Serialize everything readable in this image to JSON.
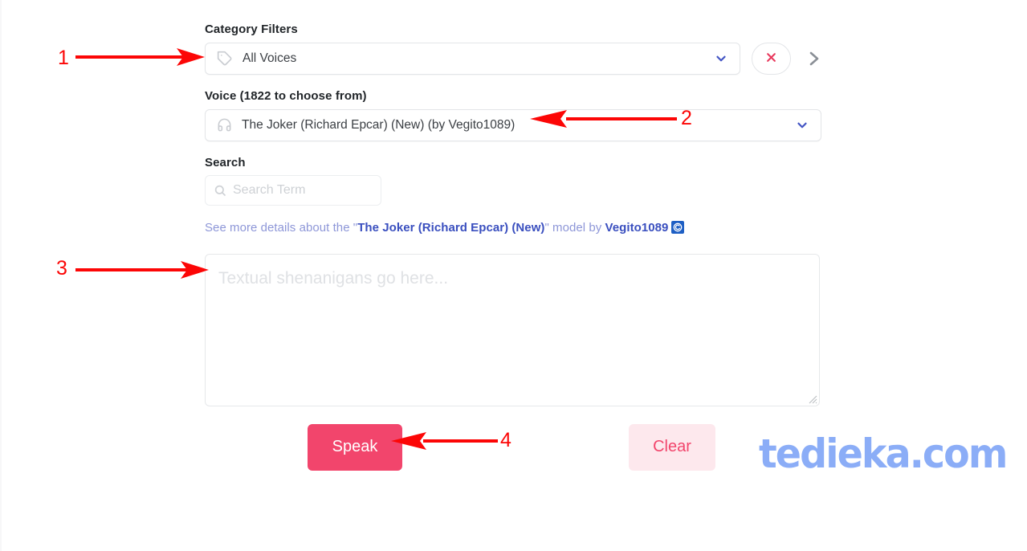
{
  "page": {
    "background": "#ffffff"
  },
  "category_filter": {
    "label": "Category Filters",
    "icon": "tag-icon",
    "value": "All Voices",
    "chevron_icon": "chevron-down-icon",
    "clear_button_icon": "close-x-icon",
    "next_button_icon": "chevron-right-icon",
    "accent": "#4355c4",
    "clear_color": "#e8385c"
  },
  "voice": {
    "label": "Voice (1822 to choose from)",
    "icon": "headphones-icon",
    "value": "The Joker (Richard Epcar) (New) (by Vegito1089)",
    "chevron_icon": "chevron-down-icon"
  },
  "search": {
    "label": "Search",
    "icon": "search-icon",
    "value": "",
    "placeholder": "Search Term"
  },
  "details": {
    "prefix": "See more details about the \"",
    "model_name": "The Joker (Richard Epcar) (New)",
    "middle": "\" model by ",
    "author": "Vegito1089",
    "badge_icon": "spiral-badge-icon",
    "link_color": "#3a4fbf"
  },
  "text_input": {
    "value": "",
    "placeholder": "Textual shenanigans go here..."
  },
  "actions": {
    "speak_label": "Speak",
    "speak_color": "#f2456c",
    "clear_label": "Clear",
    "clear_bg": "#fde8ed",
    "clear_color": "#f2456c"
  },
  "watermark": {
    "text": "tedieka.com",
    "color": "#8badf7"
  },
  "annotations": {
    "color": "#fc0606",
    "items": [
      {
        "number": "1",
        "target": "category-filter-select"
      },
      {
        "number": "2",
        "target": "voice-select"
      },
      {
        "number": "3",
        "target": "text-input-textarea"
      },
      {
        "number": "4",
        "target": "speak-button"
      }
    ]
  }
}
